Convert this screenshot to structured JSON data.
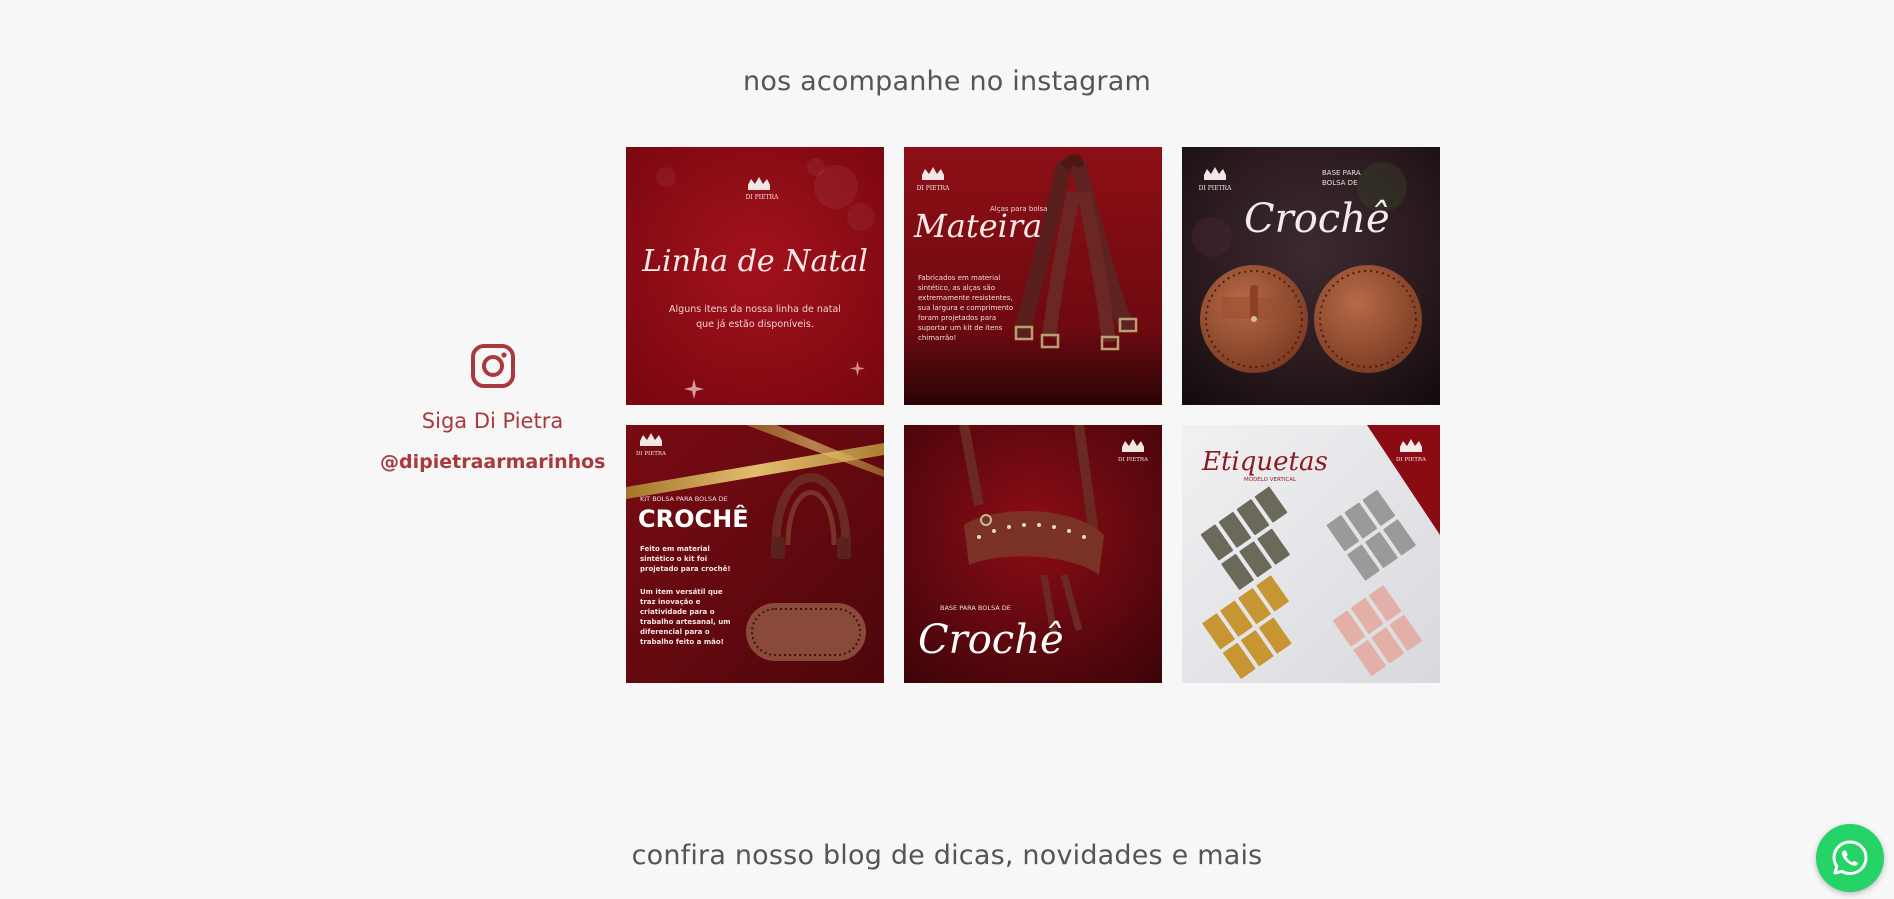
{
  "instagram_section": {
    "title": "nos acompanhe no instagram",
    "follow_text": "Siga Di Pietra",
    "handle": "@dipietraarmarinhos",
    "posts": [
      {
        "brand": "DI PIETRA",
        "headline": "Linha de Natal",
        "caption_line1": "Alguns itens da nossa linha de natal",
        "caption_line2": "que já estão disponíveis."
      },
      {
        "brand": "DI PIETRA",
        "kicker": "Alças para bolsa",
        "headline": "Mateira",
        "body": [
          "Fabricados em material",
          "sintético, as alças são",
          "extremamente resistentes,",
          "sua largura e comprimento",
          "foram projetados para",
          "suportar um kit de itens",
          "chimarrão!"
        ]
      },
      {
        "brand": "DI PIETRA",
        "kicker_line1": "BASE PARA",
        "kicker_line2": "BOLSA DE",
        "headline": "Crochê"
      },
      {
        "brand": "DI PIETRA",
        "kicker": "KIT BOLSA PARA BOLSA DE",
        "headline": "CROCHÊ",
        "body1": [
          "Feito em material",
          "sintético o kit foi",
          "projetado para crochê!"
        ],
        "body2": [
          "Um item versátil que",
          "traz inovação e",
          "criatividade para o",
          "trabalho artesanal, um",
          "diferencial para o",
          "trabalho feito a mão!"
        ]
      },
      {
        "brand": "DI PIETRA",
        "kicker": "BASE PARA BOLSA DE",
        "headline": "Crochê"
      },
      {
        "brand": "DI PIETRA",
        "headline": "Etiquetas",
        "sub": "MODELO VERTICAL"
      }
    ]
  },
  "blog_section": {
    "title": "confira nosso blog de dicas, novidades e mais"
  },
  "colors": {
    "brand_red": "#a8393c",
    "background": "#f7f7f7",
    "whatsapp_green": "#25d366"
  },
  "icons": {
    "instagram": "instagram-icon",
    "whatsapp": "whatsapp-icon"
  }
}
